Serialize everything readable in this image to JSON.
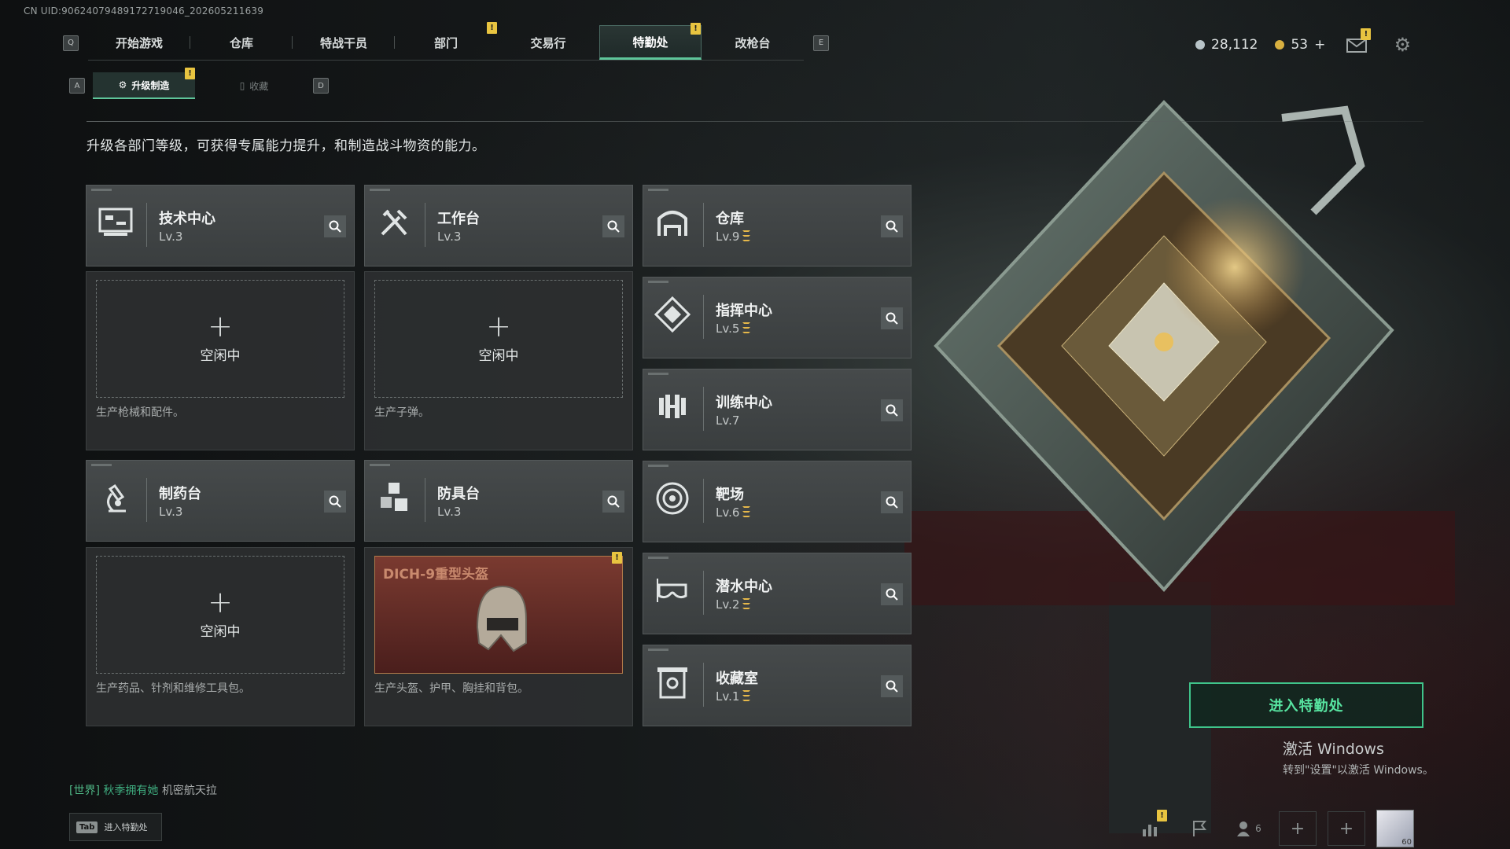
{
  "uid_text": "CN UID:9062407948917271904​6_202605211639",
  "nav": {
    "key_left": "Q",
    "key_right": "E",
    "tabs": [
      "开始游戏",
      "仓库",
      "特战干员",
      "部门",
      "交易行",
      "特勤处",
      "改枪台"
    ],
    "active_tab": "特勤处",
    "warn_badge": "!"
  },
  "subnav": {
    "key_left": "A",
    "key_right": "D",
    "tabs": [
      "升级制造",
      "收藏"
    ],
    "active": "升级制造"
  },
  "currency": {
    "silver": "28,112",
    "gold": "53",
    "gold_add": "+",
    "silver_color": "#b8c4c8",
    "gold_color": "#d8b040"
  },
  "description": "升级各部门等级，可获得专属能力提升，和制造战斗物资的能力。",
  "accent_color": "#5ec59a",
  "departments_left": [
    {
      "name": "技术中心",
      "level": "Lv.3",
      "icon": "computer-icon",
      "slot": {
        "state": "空闲中",
        "plus": "+"
      },
      "desc": "生产枪械和配件。"
    },
    {
      "name": "工作台",
      "level": "Lv.3",
      "icon": "tools-icon",
      "slot": {
        "state": "空闲中",
        "plus": "+"
      },
      "desc": "生产子弹。"
    },
    {
      "name": "制药台",
      "level": "Lv.3",
      "icon": "microscope-icon",
      "slot": {
        "state": "空闲中",
        "plus": "+"
      },
      "desc": "生产药品、针剂和维修工具包。"
    },
    {
      "name": "防具台",
      "level": "Lv.3",
      "icon": "cubes-icon",
      "slot": {
        "item": "DICH-9重型头盔"
      },
      "desc": "生产头盔、护甲、胸挂和背包。"
    }
  ],
  "departments_right": [
    {
      "name": "仓库",
      "level": "Lv.9",
      "upgradable": true,
      "icon": "warehouse-icon"
    },
    {
      "name": "指挥中心",
      "level": "Lv.5",
      "upgradable": true,
      "icon": "command-icon"
    },
    {
      "name": "训练中心",
      "level": "Lv.7",
      "upgradable": false,
      "icon": "dumbbell-icon"
    },
    {
      "name": "靶场",
      "level": "Lv.6",
      "upgradable": true,
      "icon": "target-icon"
    },
    {
      "name": "潜水中心",
      "level": "Lv.2",
      "upgradable": true,
      "icon": "diving-mask-icon"
    },
    {
      "name": "收藏室",
      "level": "Lv.1",
      "upgradable": true,
      "icon": "collection-icon"
    }
  ],
  "enter_button": "进入特勤处",
  "windows": {
    "title": "激活 Windows",
    "subtitle": "转到\"设置\"以激活 Windows。"
  },
  "chat": {
    "channel": "[世界]",
    "name": "秋季拥有她",
    "message": "机密航天拉"
  },
  "tab_hint": {
    "key": "Tab",
    "label": "进入特勤处"
  },
  "friends_count": "6",
  "avatar_level": "60"
}
